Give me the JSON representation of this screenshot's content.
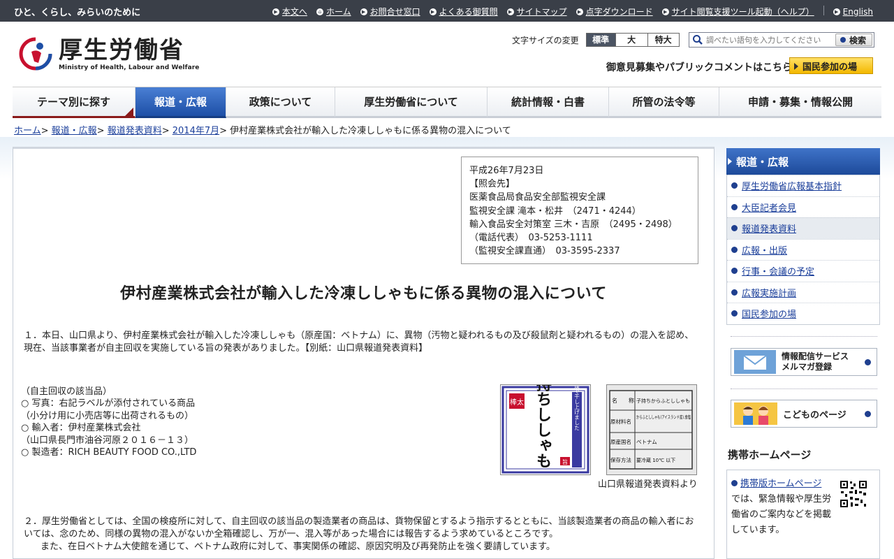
{
  "topbar": {
    "tagline": "ひと、くらし、みらいのために",
    "links": [
      "本文へ",
      "ホーム",
      "お問合せ窓口",
      "よくある御質問",
      "サイトマップ",
      "点字ダウンロード",
      "サイト閲覧支援ツール起動（ヘルプ）"
    ],
    "english": "English"
  },
  "header": {
    "logo_jp": "厚生労働省",
    "logo_en": "Ministry of Health, Labour and Welfare",
    "fontsize_label": "文字サイズの変更",
    "fontsize_options": [
      "標準",
      "大",
      "特大"
    ],
    "search_placeholder": "調べたい語句を入力してください",
    "search_button": "検索",
    "pubcomment": "御意見募集やパブリックコメントはこちら",
    "kokumin": "国民参加の場"
  },
  "nav": [
    "テーマ別に探す",
    "報道・広報",
    "政策について",
    "厚生労働省について",
    "統計情報・白書",
    "所管の法令等",
    "申請・募集・情報公開"
  ],
  "breadcrumb": {
    "links": [
      "ホーム",
      "報道・広報",
      "報道発表資料",
      "2014年7月"
    ],
    "current": "伊村産業株式会社が輸入した冷凍ししゃもに係る異物の混入について"
  },
  "infobox": "平成26年7月23日\n【照会先】\n医薬食品局食品安全部監視安全課\n監視安全課 滝本・松井　（2471・4244）\n輸入食品安全対策室 三木・吉原　（2495・2498）\n（電話代表）　03-5253-1111\n（監視安全課直通）　03-3595-2337",
  "article": {
    "title": "伊村産業株式会社が輸入した冷凍ししゃもに係る異物の混入について",
    "p1": "１．本日、山口県より、伊村産業株式会社が輸入した冷凍ししゃも（原産国：ベトナム）に、異物（汚物と疑われるもの及び殺鼠剤と疑われるもの）の混入を認め、現在、当該事業者が自主回収を実施している旨の発表がありました。【別紙：山口県報道発表資料】",
    "recall": "（自主回収の該当品）\n○ 写真：右記ラベルが添付されている商品\n（小分け用に小売店等に出荷されるもの）\n○ 輸入者：伊村産業株式会社\n（山口県長門市油谷河原２０１６－１３）\n○ 製造者：RICH BEAUTY FOOD CO.,LTD",
    "photo_caption": "山口県報道発表資料より",
    "label1": {
      "badge": "棒太",
      "main": "子持ちししゃも",
      "side": "冷風乾燥で干し上げました",
      "stamp": "旨"
    },
    "label2": {
      "rows": [
        [
          "名",
          "称",
          "子持ちからふとししゃも"
        ],
        [
          "原材料名",
          "からふとししゃも(アイスランド産),食塩"
        ],
        [
          "原産国名",
          "ベトナム"
        ],
        [
          "保存方法",
          "要冷蔵 10℃ 以下"
        ]
      ]
    },
    "p2a": "２．厚生労働省としては、全国の検疫所に対して、自主回収の該当品の製造業者の商品は、貨物保留とするよう指示するとともに、当該製造業者の商品の輸入者においては、念のため、同様の異物の混入がないか全箱確認し、万が一、混入等があった場合には報告するよう求めているところです。",
    "p2b": "また、在日ベトナム大使館を通じて、ベトナム政府に対して、事実関係の確認、原因究明及び再発防止を強く要請しています。"
  },
  "sidebar": {
    "head": "報道・広報",
    "items": [
      "厚生労働省広報基本指針",
      "大臣記者会見",
      "報道発表資料",
      "広報・出版",
      "行事・会議の予定",
      "広報実施計画",
      "国民参加の場"
    ],
    "mail_banner": [
      "情報配信サービス",
      "メルマガ登録"
    ],
    "kids_banner": "こどものページ",
    "keitai_head": "携帯ホームページ",
    "keitai_link": "携帯版ホームページ",
    "keitai_text": "では、緊急情報や厚生労働省のご案内などを掲載しています。"
  },
  "colors": {
    "accent": "#1d4fa6",
    "topbar": "#3a3f48",
    "brand_red": "#c8102e"
  }
}
